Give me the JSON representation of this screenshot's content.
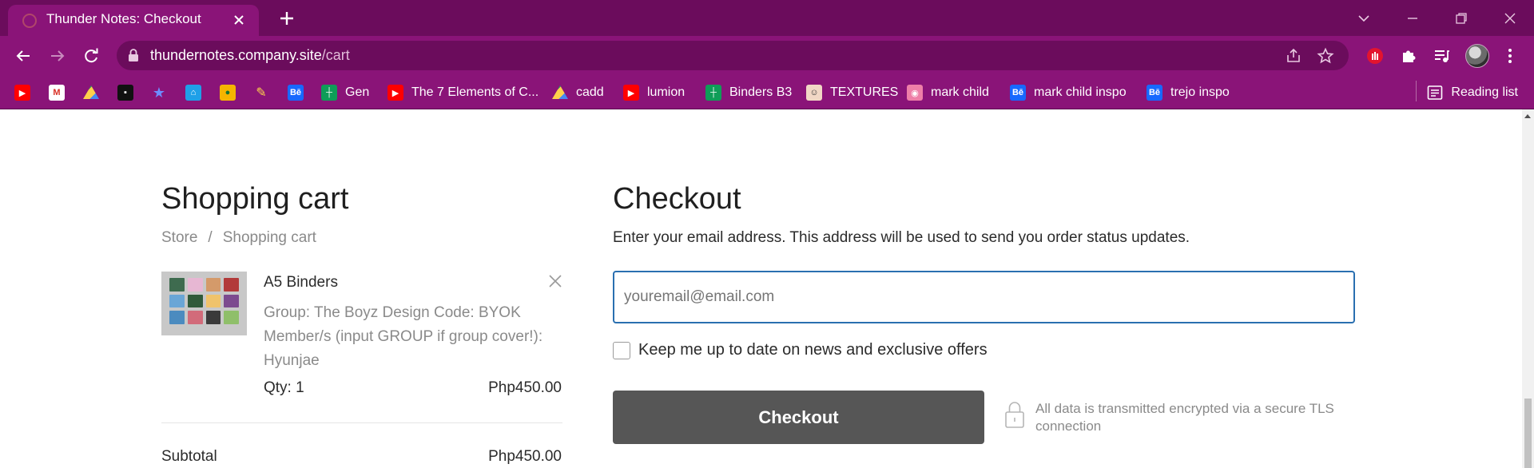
{
  "browser": {
    "tab_title": "Thunder Notes: Checkout",
    "url_host": "thundernotes.company.site",
    "url_path": "/cart",
    "bookmarks": [
      {
        "icon": "youtube-icon",
        "label": ""
      },
      {
        "icon": "gmail-icon",
        "label": ""
      },
      {
        "icon": "drive-icon",
        "label": ""
      },
      {
        "icon": "dark-square-icon",
        "label": ""
      },
      {
        "icon": "star-sparkle-icon",
        "label": ""
      },
      {
        "icon": "shop-icon",
        "label": ""
      },
      {
        "icon": "contacts-icon",
        "label": ""
      },
      {
        "icon": "paint-icon",
        "label": ""
      },
      {
        "icon": "behance-icon",
        "label": ""
      },
      {
        "icon": "sheets-icon",
        "label": "Gen"
      },
      {
        "icon": "youtube-icon",
        "label": "The 7 Elements of C..."
      },
      {
        "icon": "drive-icon",
        "label": "cadd"
      },
      {
        "icon": "youtube-icon",
        "label": "lumion"
      },
      {
        "icon": "sheets-icon",
        "label": "Binders B3"
      },
      {
        "icon": "person-icon",
        "label": "TEXTURES"
      },
      {
        "icon": "photo-icon",
        "label": "mark child"
      },
      {
        "icon": "behance-icon",
        "label": "mark child inspo"
      },
      {
        "icon": "behance-icon",
        "label": "trejo inspo"
      }
    ],
    "reading_list": "Reading list",
    "colors": {
      "frame": "#6b0c5c",
      "toolbar": "#8a1478"
    }
  },
  "cart": {
    "title": "Shopping cart",
    "breadcrumb": {
      "store": "Store",
      "separator": "/",
      "current": "Shopping cart"
    },
    "item": {
      "name": "A5 Binders",
      "options": "Group: The Boyz  Design Code: BYOK Member/s (input GROUP if group cover!): Hyunjae",
      "qty": "Qty: 1",
      "price": "Php450.00"
    },
    "subtotal_label": "Subtotal",
    "subtotal_value": "Php450.00"
  },
  "checkout": {
    "title": "Checkout",
    "description": "Enter your email address. This address will be used to send you order status updates.",
    "email_placeholder": "youremail@email.com",
    "newsletter_label": "Keep me up to date on news and exclusive offers",
    "newsletter_checked": false,
    "button_label": "Checkout",
    "secure_note": "All data is transmitted encrypted via a secure TLS connection",
    "button_color": "#565656",
    "input_border_color": "#2a6fb0"
  }
}
